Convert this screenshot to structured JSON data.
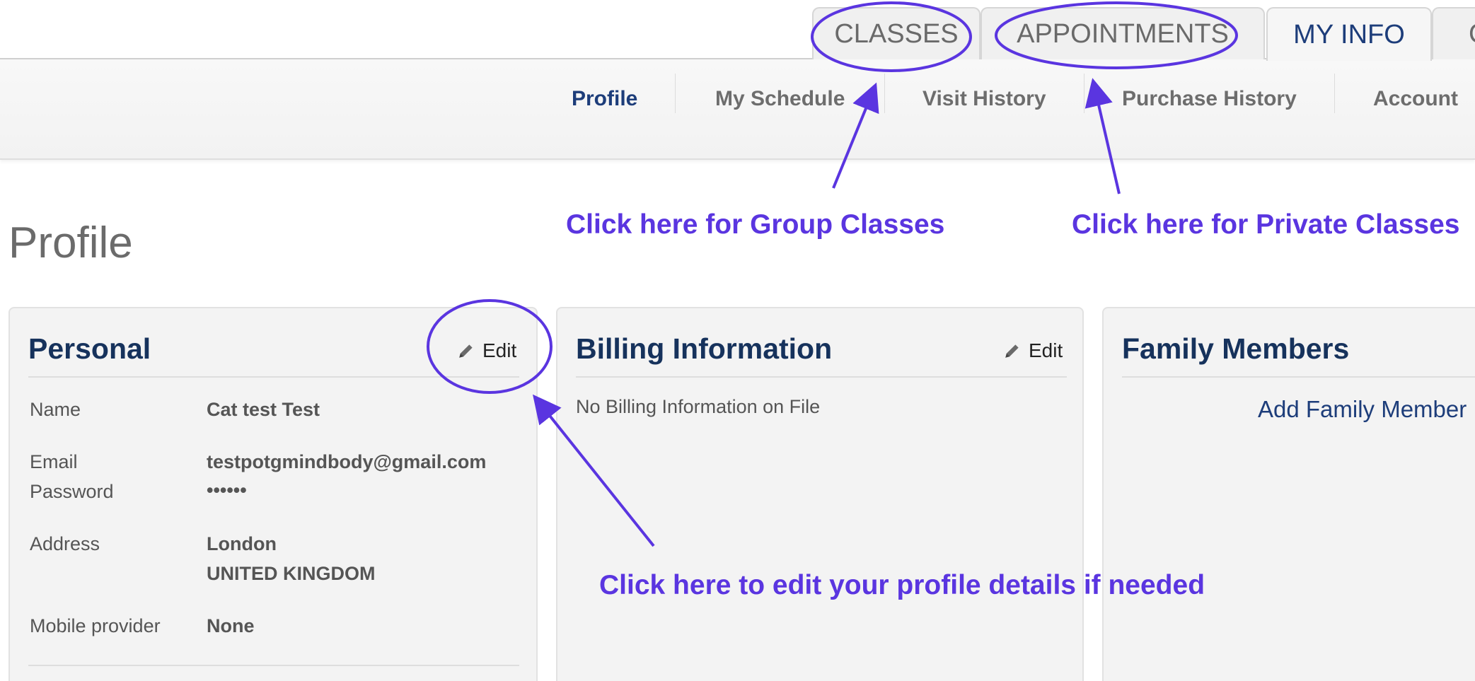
{
  "tabs": [
    {
      "label": "CLASSES"
    },
    {
      "label": "APPOINTMENTS"
    },
    {
      "label": "MY INFO"
    },
    {
      "label": "C"
    }
  ],
  "subnav": [
    {
      "label": "Profile"
    },
    {
      "label": "My Schedule"
    },
    {
      "label": "Visit History"
    },
    {
      "label": "Purchase History"
    },
    {
      "label": "Account"
    }
  ],
  "page_title": "Profile",
  "personal": {
    "title": "Personal",
    "edit_label": "Edit",
    "name_label": "Name",
    "name_value": "Cat test Test",
    "email_label": "Email",
    "email_value": "testpotgmindbody@gmail.com",
    "password_label": "Password",
    "password_value": "••••••",
    "address_label": "Address",
    "address_line1": "London",
    "address_line2": "UNITED KINGDOM",
    "mobile_label": "Mobile provider",
    "mobile_value": "None"
  },
  "billing": {
    "title": "Billing Information",
    "edit_label": "Edit",
    "empty_text": "No Billing Information on File"
  },
  "family": {
    "title": "Family Members",
    "add_label": "Add Family Member"
  },
  "annotations": {
    "group_classes": "Click here for Group Classes",
    "private_classes": "Click here for Private Classes",
    "edit_profile": "Click here to edit your profile details if needed",
    "color": "#5a35e0"
  }
}
